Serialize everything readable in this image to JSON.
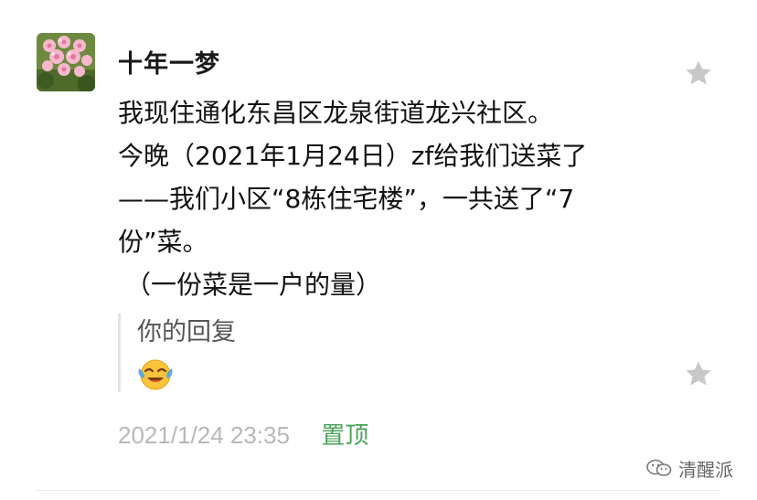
{
  "comment": {
    "author": "十年一梦",
    "lines": [
      "我现住通化东昌区龙泉街道龙兴社区。",
      "今晚（2021年1月24日）zf给我们送菜了",
      "——我们小区“8栋住宅楼”，一共送了“7",
      "份”菜。",
      "（一份菜是一户的量）"
    ],
    "reply_label": "你的回复",
    "reply_emoji_icon": "laughing-crying-face-icon",
    "timestamp": "2021/1/24 23:35",
    "pin_label": "置顶"
  },
  "watermark": {
    "text": "清醒派",
    "icon": "wechat-channel-icon"
  },
  "colors": {
    "star": "#c8c8c8",
    "pin": "#4aa35a",
    "timestamp": "#b8b8b8"
  }
}
